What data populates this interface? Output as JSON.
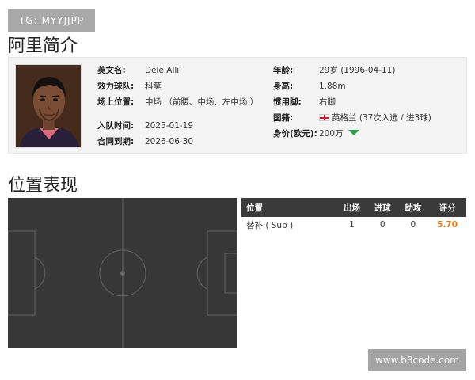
{
  "watermark_top": "TG: MYYJJPP",
  "watermark_bottom": "www.b8code.com",
  "profile_section_title": "阿里简介",
  "position_section_title": "位置表现",
  "profile": {
    "left": [
      {
        "label": "英文名:",
        "value": "Dele Alli"
      },
      {
        "label": "效力球队:",
        "value": "科莫"
      },
      {
        "label": "场上位置:",
        "value": "中场 （前腰、中场、左中场 ）"
      },
      {
        "label": "入队时间:",
        "value": "2025-01-19"
      },
      {
        "label": "合同到期:",
        "value": "2026-06-30"
      }
    ],
    "right": [
      {
        "label": "年龄:",
        "value": "29岁  (1996-04-11)"
      },
      {
        "label": "身高:",
        "value": "1.88m"
      },
      {
        "label": "惯用脚:",
        "value": "右脚"
      },
      {
        "label": "国籍:",
        "value": "英格兰 (37次入选 / 进3球)",
        "icon": "england-flag-icon"
      },
      {
        "label": "身价(欧元):",
        "value": "200万",
        "icon": "trend-down-icon",
        "icon_color": "#2e9e4f"
      }
    ]
  },
  "position_table": {
    "headers": [
      "位置",
      "出场",
      "进球",
      "助攻",
      "评分"
    ],
    "rows": [
      {
        "position": "替补 ( Sub )",
        "appearances": "1",
        "goals": "0",
        "assists": "0",
        "rating": "5.70"
      }
    ],
    "rating_color": "#e07b1a"
  },
  "colors": {
    "pitch": "#373737",
    "table_header": "#3a3a3a",
    "profile_bg": "#f4f4f4"
  }
}
